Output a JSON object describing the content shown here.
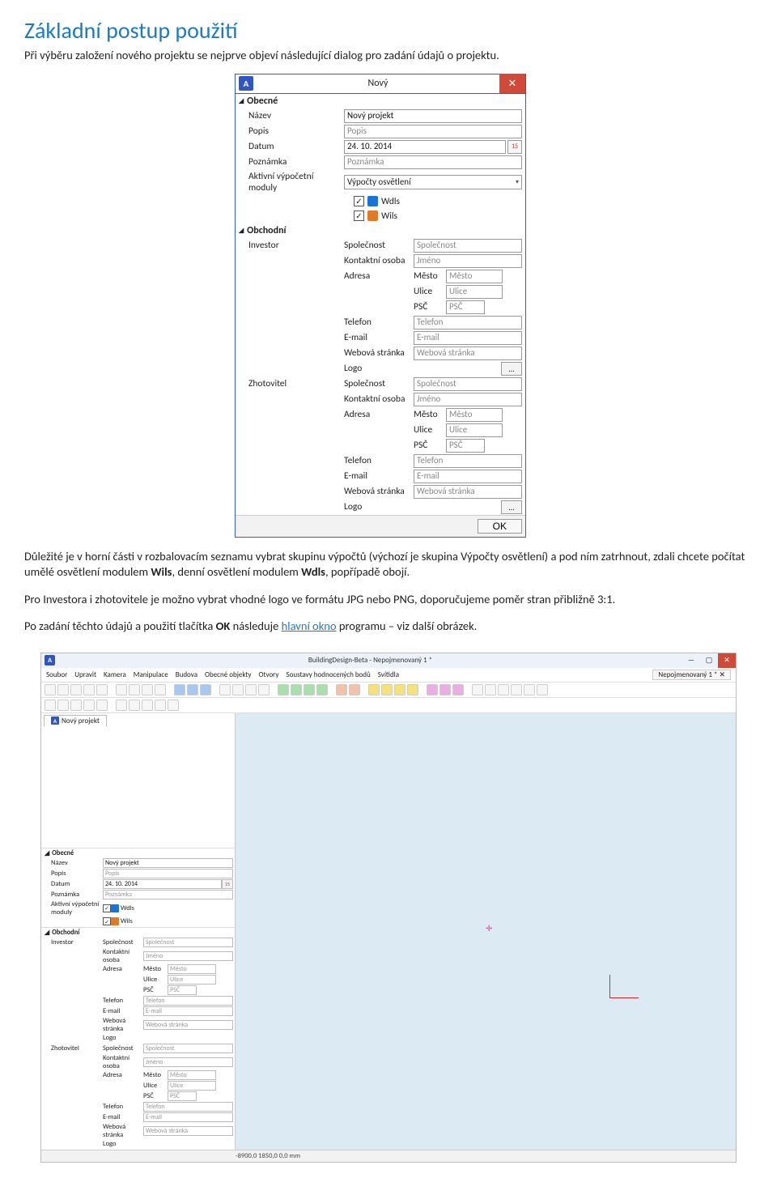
{
  "heading": "Základní postup použití",
  "intro": "Při výběru založení nového projektu se nejprve objeví následující dialog pro zadání údajů o projektu.",
  "para1_pre": "Důležité je v horní části v rozbalovacím seznamu vybrat skupinu výpočtů (výchozí je skupina Výpočty osvětlení) a pod ním zatrhnout, zdali chcete počítat umělé osvětlení modulem ",
  "para1_b1": "Wils",
  "para1_mid": ", denní osvětlení modulem ",
  "para1_b2": "Wdls",
  "para1_post": ", popřípadě obojí.",
  "para2": "Pro Investora i zhotovitele je možno vybrat vhodné logo ve formátu JPG nebo PNG, doporučujeme poměr stran přibližně 3:1.",
  "para3_pre": "Po zadání těchto údajů a použití tlačítka ",
  "para3_b": "OK",
  "para3_mid": " následuje ",
  "para3_link": "hlavní okno",
  "para3_post": " programu – viz další obrázek.",
  "dialog": {
    "app_letter": "A",
    "title": "Nový",
    "close": "✕",
    "section_general": "Obecné",
    "name_label": "Název",
    "name_value": "Nový projekt",
    "desc_label": "Popis",
    "desc_placeholder": "Popis",
    "date_label": "Datum",
    "date_value": "24. 10. 2014",
    "cal_text": "15",
    "note_label": "Poznámka",
    "note_placeholder": "Poznámka",
    "modules_label": "Aktivní výpočetní moduly",
    "modules_value": "Výpočty osvětlení",
    "chk_wdls": "Wdls",
    "chk_wils": "Wils",
    "section_business": "Obchodní",
    "investor_label": "Investor",
    "contractor_label": "Zhotovitel",
    "company_label": "Společnost",
    "company_placeholder": "Společnost",
    "contact_label": "Kontaktní osoba",
    "contact_placeholder": "Jméno",
    "address_label": "Adresa",
    "city_label": "Město",
    "city_placeholder": "Město",
    "street_label": "Ulice",
    "street_placeholder": "Ulice",
    "psc_label": "PSČ",
    "psc_placeholder": "PSČ",
    "phone_label": "Telefon",
    "phone_placeholder": "Telefon",
    "email_label": "E-mail",
    "email_placeholder": "E-mail",
    "web_label": "Webová stránka",
    "web_placeholder": "Webová stránka",
    "logo_label": "Logo",
    "logo_btn": "...",
    "ok": "OK"
  },
  "mainwin": {
    "title": "BuildingDesign-Beta - Nepojmenovaný 1 *",
    "tab_right": "Nepojmenovaný 1 * ✕",
    "menu": [
      "Soubor",
      "Upravit",
      "Kamera",
      "Manipulace",
      "Budova",
      "Obecné objekty",
      "Otvory",
      "Soustavy hodnocených bodů",
      "Svítidla"
    ],
    "tab_name": "Nový projekt",
    "section_general": "Obecné",
    "name_label": "Název",
    "name_value": "Nový projekt",
    "desc_label": "Popis",
    "desc_placeholder": "Popis",
    "date_label": "Datum",
    "date_value": "24. 10. 2014",
    "note_label": "Poznámka",
    "note_placeholder": "Poznámka",
    "modules_label": "Aktivní výpočetní moduly",
    "chk_wdls": "Wdls",
    "chk_wils": "Wils",
    "section_business": "Obchodní",
    "investor_label": "Investor",
    "contractor_label": "Zhotovitel",
    "company_label": "Společnost",
    "company_placeholder": "Společnost",
    "contact_label": "Kontaktní osoba",
    "contact_placeholder": "Jméno",
    "address_label": "Adresa",
    "city_label": "Město",
    "city_placeholder": "Město",
    "street_label": "Ulice",
    "street_placeholder": "Ulice",
    "psc_label": "PSČ",
    "psc_placeholder": "PSČ",
    "phone_label": "Telefon",
    "phone_placeholder": "Telefon",
    "email_label": "E-mail",
    "email_placeholder": "E-mail",
    "web_label": "Webová stránka",
    "web_placeholder": "Webová stránka",
    "logo_label": "Logo",
    "status": "-8900,0   1850,0   0,0  mm"
  }
}
